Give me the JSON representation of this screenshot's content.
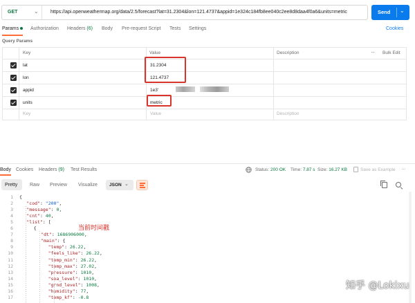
{
  "request": {
    "method": "GET",
    "url": "https://api.openweathermap.org/data/2.5/forecast?lat=31.2304&lon=121.4737&appid=1e324c184fb8ee040c2ee8d8daa4f0a6&units=metric",
    "send_label": "Send"
  },
  "tabs": {
    "params": "Params",
    "authorization": "Authorization",
    "headers": "Headers",
    "headers_count": "(6)",
    "body": "Body",
    "prerequest": "Pre-request Script",
    "tests": "Tests",
    "settings": "Settings",
    "cookies": "Cookies"
  },
  "query_params": {
    "title": "Query Params",
    "col_key": "Key",
    "col_value": "Value",
    "col_description": "Description",
    "bulk_edit": "Bulk Edit",
    "rows": [
      {
        "key": "lat",
        "value": "31.2304"
      },
      {
        "key": "lon",
        "value": "121.4737"
      },
      {
        "key": "appid",
        "value": "1e3'"
      },
      {
        "key": "units",
        "value": "metric"
      }
    ],
    "placeholder_key": "Key",
    "placeholder_value": "Value",
    "placeholder_description": "Description"
  },
  "response": {
    "tabs": {
      "body": "Body",
      "cookies": "Cookies",
      "headers": "Headers",
      "headers_count": "(9)",
      "test_results": "Test Results"
    },
    "status_label": "Status:",
    "status_value": "200 OK",
    "time_label": "Time:",
    "time_value": "7.87 s",
    "size_label": "Size:",
    "size_value": "16.27 KB",
    "save_example": "Save as Example",
    "format_tabs": {
      "pretty": "Pretty",
      "raw": "Raw",
      "preview": "Preview",
      "visualize": "Visualize"
    },
    "format": "JSON"
  },
  "code_lines": [
    {
      "n": "1",
      "text": "{"
    },
    {
      "n": "2",
      "key": "\"cod\"",
      "sep": ": ",
      "val": "\"200\"",
      "vt": "s",
      "tail": ","
    },
    {
      "n": "3",
      "key": "\"message\"",
      "sep": ": ",
      "val": "0",
      "vt": "n",
      "tail": ","
    },
    {
      "n": "4",
      "key": "\"cnt\"",
      "sep": ": ",
      "val": "40",
      "vt": "n",
      "tail": ","
    },
    {
      "n": "5",
      "key": "\"list\"",
      "sep": ": ",
      "val": "",
      "vt": "n",
      "tail": "["
    },
    {
      "n": "6",
      "text": "{"
    },
    {
      "n": "7",
      "key": "\"dt\"",
      "sep": ": ",
      "val": "1686906000",
      "vt": "n",
      "tail": ","
    },
    {
      "n": "8",
      "key": "\"main\"",
      "sep": ": ",
      "val": "",
      "vt": "n",
      "tail": "{"
    },
    {
      "n": "9",
      "key": "\"temp\"",
      "sep": ": ",
      "val": "26.22",
      "vt": "n",
      "tail": ","
    },
    {
      "n": "10",
      "key": "\"feels_like\"",
      "sep": ": ",
      "val": "26.22",
      "vt": "n",
      "tail": ","
    },
    {
      "n": "11",
      "key": "\"temp_min\"",
      "sep": ": ",
      "val": "26.22",
      "vt": "n",
      "tail": ","
    },
    {
      "n": "12",
      "key": "\"temp_max\"",
      "sep": ": ",
      "val": "27.02",
      "vt": "n",
      "tail": ","
    },
    {
      "n": "13",
      "key": "\"pressure\"",
      "sep": ": ",
      "val": "1010",
      "vt": "n",
      "tail": ","
    },
    {
      "n": "14",
      "key": "\"sea_level\"",
      "sep": ": ",
      "val": "1010",
      "vt": "n",
      "tail": ","
    },
    {
      "n": "15",
      "key": "\"grnd_level\"",
      "sep": ": ",
      "val": "1008",
      "vt": "n",
      "tail": ","
    },
    {
      "n": "16",
      "key": "\"humidity\"",
      "sep": ": ",
      "val": "77",
      "vt": "n",
      "tail": ","
    },
    {
      "n": "17",
      "key": "\"temp_kf\"",
      "sep": ": ",
      "val": "-0.8",
      "vt": "n",
      "tail": ""
    }
  ],
  "annotation": "当前时间戳",
  "watermark": "知乎 @Lokixu",
  "colors": {
    "accent": "#ff6c37",
    "send_button": "#097bed",
    "status_ok": "#0a7a3f",
    "annotation_red": "#d9342b"
  }
}
